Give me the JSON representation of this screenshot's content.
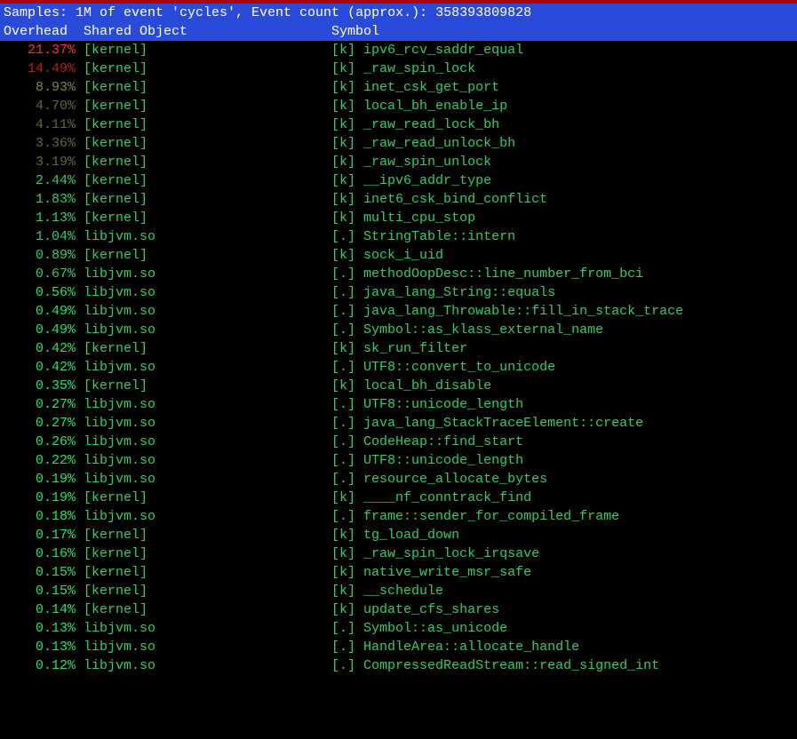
{
  "header": {
    "line": "Samples: 1M of event 'cycles', Event count (approx.): 358393809828",
    "col_overhead": "Overhead",
    "col_shared_object": "Shared Object",
    "col_symbol": "Symbol"
  },
  "colors": {
    "red": "#ff3030",
    "dark_red": "#b82020",
    "olive": "#7a8a3a",
    "dim_olive": "#5e6a40",
    "green": "#33cc66",
    "bright_green": "#22e26a",
    "white": "#ffffff"
  },
  "rows": [
    {
      "overhead": "21.37%",
      "overhead_color": "red",
      "so": "[kernel]",
      "tag": "[k]",
      "sym": "ipv6_rcv_saddr_equal"
    },
    {
      "overhead": "14.49%",
      "overhead_color": "dark_red",
      "so": "[kernel]",
      "tag": "[k]",
      "sym": "_raw_spin_lock"
    },
    {
      "overhead": "8.93%",
      "overhead_color": "olive",
      "so": "[kernel]",
      "tag": "[k]",
      "sym": "inet_csk_get_port"
    },
    {
      "overhead": "4.70%",
      "overhead_color": "dim_olive",
      "so": "[kernel]",
      "tag": "[k]",
      "sym": "local_bh_enable_ip"
    },
    {
      "overhead": "4.11%",
      "overhead_color": "dim_olive",
      "so": "[kernel]",
      "tag": "[k]",
      "sym": "_raw_read_lock_bh"
    },
    {
      "overhead": "3.36%",
      "overhead_color": "dim_olive",
      "so": "[kernel]",
      "tag": "[k]",
      "sym": "_raw_read_unlock_bh"
    },
    {
      "overhead": "3.19%",
      "overhead_color": "dim_olive",
      "so": "[kernel]",
      "tag": "[k]",
      "sym": "_raw_spin_unlock"
    },
    {
      "overhead": "2.44%",
      "overhead_color": "green",
      "so": "[kernel]",
      "tag": "[k]",
      "sym": "__ipv6_addr_type"
    },
    {
      "overhead": "1.83%",
      "overhead_color": "green",
      "so": "[kernel]",
      "tag": "[k]",
      "sym": "inet6_csk_bind_conflict"
    },
    {
      "overhead": "1.13%",
      "overhead_color": "green",
      "so": "[kernel]",
      "tag": "[k]",
      "sym": "multi_cpu_stop"
    },
    {
      "overhead": "1.04%",
      "overhead_color": "green",
      "so": "libjvm.so",
      "tag": "[.]",
      "sym": "StringTable::intern"
    },
    {
      "overhead": "0.89%",
      "overhead_color": "green",
      "so": "[kernel]",
      "tag": "[k]",
      "sym": "sock_i_uid"
    },
    {
      "overhead": "0.67%",
      "overhead_color": "green",
      "so": "libjvm.so",
      "tag": "[.]",
      "sym": "methodOopDesc::line_number_from_bci"
    },
    {
      "overhead": "0.56%",
      "overhead_color": "bright_green",
      "so": "libjvm.so",
      "tag": "[.]",
      "sym": "java_lang_String::equals"
    },
    {
      "overhead": "0.49%",
      "overhead_color": "bright_green",
      "so": "libjvm.so",
      "tag": "[.]",
      "sym": "java_lang_Throwable::fill_in_stack_trace"
    },
    {
      "overhead": "0.49%",
      "overhead_color": "bright_green",
      "so": "libjvm.so",
      "tag": "[.]",
      "sym": "Symbol::as_klass_external_name"
    },
    {
      "overhead": "0.42%",
      "overhead_color": "bright_green",
      "so": "[kernel]",
      "tag": "[k]",
      "sym": "sk_run_filter"
    },
    {
      "overhead": "0.42%",
      "overhead_color": "bright_green",
      "so": "libjvm.so",
      "tag": "[.]",
      "sym": "UTF8::convert_to_unicode"
    },
    {
      "overhead": "0.35%",
      "overhead_color": "bright_green",
      "so": "[kernel]",
      "tag": "[k]",
      "sym": "local_bh_disable"
    },
    {
      "overhead": "0.27%",
      "overhead_color": "bright_green",
      "so": "libjvm.so",
      "tag": "[.]",
      "sym": "UTF8::unicode_length"
    },
    {
      "overhead": "0.27%",
      "overhead_color": "bright_green",
      "so": "libjvm.so",
      "tag": "[.]",
      "sym": "java_lang_StackTraceElement::create"
    },
    {
      "overhead": "0.26%",
      "overhead_color": "bright_green",
      "so": "libjvm.so",
      "tag": "[.]",
      "sym": "CodeHeap::find_start"
    },
    {
      "overhead": "0.22%",
      "overhead_color": "bright_green",
      "so": "libjvm.so",
      "tag": "[.]",
      "sym": "UTF8::unicode_length"
    },
    {
      "overhead": "0.19%",
      "overhead_color": "bright_green",
      "so": "libjvm.so",
      "tag": "[.]",
      "sym": "resource_allocate_bytes"
    },
    {
      "overhead": "0.19%",
      "overhead_color": "bright_green",
      "so": "[kernel]",
      "tag": "[k]",
      "sym": "____nf_conntrack_find"
    },
    {
      "overhead": "0.18%",
      "overhead_color": "bright_green",
      "so": "libjvm.so",
      "tag": "[.]",
      "sym": "frame::sender_for_compiled_frame"
    },
    {
      "overhead": "0.17%",
      "overhead_color": "bright_green",
      "so": "[kernel]",
      "tag": "[k]",
      "sym": "tg_load_down"
    },
    {
      "overhead": "0.16%",
      "overhead_color": "bright_green",
      "so": "[kernel]",
      "tag": "[k]",
      "sym": "_raw_spin_lock_irqsave"
    },
    {
      "overhead": "0.15%",
      "overhead_color": "bright_green",
      "so": "[kernel]",
      "tag": "[k]",
      "sym": "native_write_msr_safe"
    },
    {
      "overhead": "0.15%",
      "overhead_color": "bright_green",
      "so": "[kernel]",
      "tag": "[k]",
      "sym": "__schedule"
    },
    {
      "overhead": "0.14%",
      "overhead_color": "bright_green",
      "so": "[kernel]",
      "tag": "[k]",
      "sym": "update_cfs_shares"
    },
    {
      "overhead": "0.13%",
      "overhead_color": "bright_green",
      "so": "libjvm.so",
      "tag": "[.]",
      "sym": "Symbol::as_unicode"
    },
    {
      "overhead": "0.13%",
      "overhead_color": "bright_green",
      "so": "libjvm.so",
      "tag": "[.]",
      "sym": "HandleArea::allocate_handle"
    },
    {
      "overhead": "0.12%",
      "overhead_color": "bright_green",
      "so": "libjvm.so",
      "tag": "[.]",
      "sym": "CompressedReadStream::read_signed_int"
    }
  ]
}
